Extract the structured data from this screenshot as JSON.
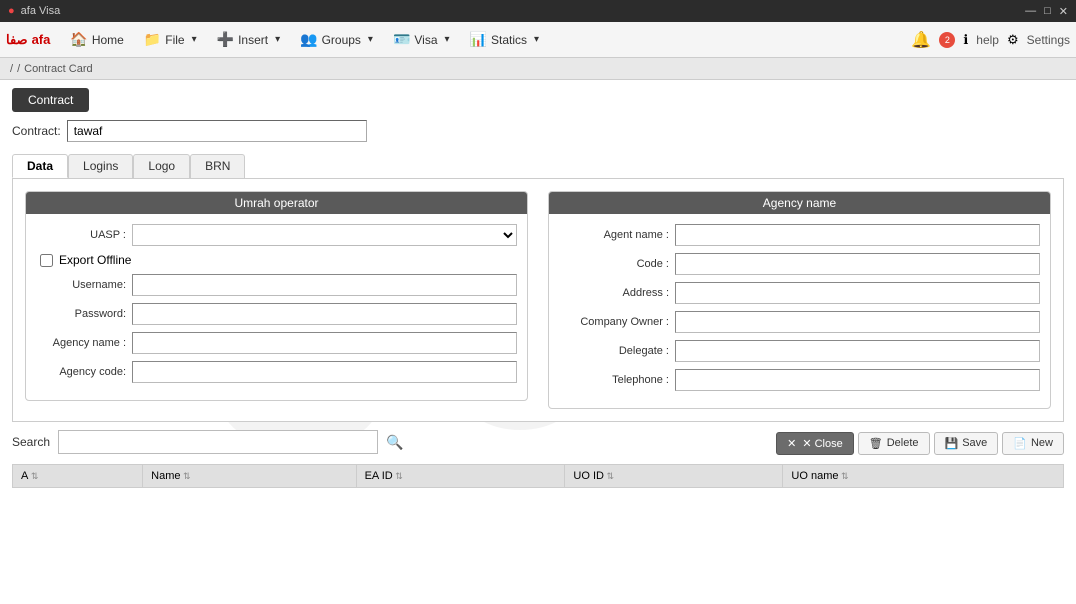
{
  "window": {
    "title": "afa Visa"
  },
  "titlebar": {
    "title": "afa Visa",
    "minimize_label": "—",
    "maximize_label": "□",
    "close_label": "✕"
  },
  "menubar": {
    "logo_text": "صفا",
    "logo_sub": "afa",
    "home_label": "Home",
    "file_label": "File",
    "insert_label": "Insert",
    "groups_label": "Groups",
    "visa_label": "Visa",
    "statics_label": "Statics",
    "notification_count": "2",
    "help_label": "help",
    "settings_label": "Settings"
  },
  "breadcrumb": {
    "home_label": "/",
    "separator": "/",
    "current_label": "Contract Card"
  },
  "contract": {
    "button_label": "Contract",
    "field_label": "Contract:",
    "field_value": "tawaf"
  },
  "tabs": {
    "items": [
      {
        "id": "data",
        "label": "Data",
        "active": true
      },
      {
        "id": "logins",
        "label": "Logins",
        "active": false
      },
      {
        "id": "logo",
        "label": "Logo",
        "active": false
      },
      {
        "id": "brn",
        "label": "BRN",
        "active": false
      }
    ]
  },
  "umrah_operator": {
    "header": "Umrah operator",
    "uasp_label": "UASP :",
    "uasp_value": "",
    "export_offline_label": "Export Offline",
    "export_offline_checked": false,
    "username_label": "Username:",
    "username_value": "",
    "password_label": "Password:",
    "password_value": "",
    "agency_name_label": "Agency name :",
    "agency_name_value": "",
    "agency_code_label": "Agency code:",
    "agency_code_value": ""
  },
  "agency_name": {
    "header": "Agency name",
    "agent_name_label": "Agent name :",
    "agent_name_value": "",
    "code_label": "Code :",
    "code_value": "",
    "address_label": "Address :",
    "address_value": "",
    "company_owner_label": "Company Owner :",
    "company_owner_value": "",
    "delegate_label": "Delegate :",
    "delegate_value": "",
    "telephone_label": "Telephone :",
    "telephone_value": ""
  },
  "search": {
    "label": "Search",
    "placeholder": "",
    "icon": "🔍"
  },
  "actions": {
    "close_label": "✕ Close",
    "delete_label": "Delete",
    "save_label": "Save",
    "new_label": "New"
  },
  "table": {
    "columns": [
      {
        "id": "col_a",
        "label": "A"
      },
      {
        "id": "name",
        "label": "Name"
      },
      {
        "id": "ea_id",
        "label": "EA ID"
      },
      {
        "id": "uo_id",
        "label": "UO ID"
      },
      {
        "id": "uo_name",
        "label": "UO name"
      }
    ],
    "rows": []
  }
}
